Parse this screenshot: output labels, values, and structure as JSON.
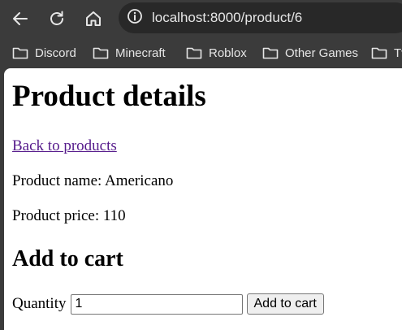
{
  "browser": {
    "url": "localhost:8000/product/6",
    "icons": {
      "back": "arrow-left-icon",
      "reload": "reload-icon",
      "home": "home-icon",
      "site_info": "info-circle-icon",
      "bookmark_folder": "folder-icon"
    },
    "bookmarks": [
      {
        "label": "Discord"
      },
      {
        "label": "Minecraft"
      },
      {
        "label": "Roblox"
      },
      {
        "label": "Other Games"
      },
      {
        "label": "Tv"
      }
    ],
    "colors": {
      "chrome_bg": "#3b3b3b",
      "omnibox_bg": "#282828",
      "chrome_text": "#e6e6e6"
    }
  },
  "page": {
    "title": "Product details",
    "back_link": "Back to products",
    "product_name_line": "Product name: Americano",
    "product_price_line": "Product price: 110",
    "cart_heading": "Add to cart",
    "quantity_label": "Quantity",
    "quantity_value": "1",
    "add_button_label": "Add to cart",
    "colors": {
      "visited_link": "#551a8b",
      "background": "#ffffff"
    }
  }
}
